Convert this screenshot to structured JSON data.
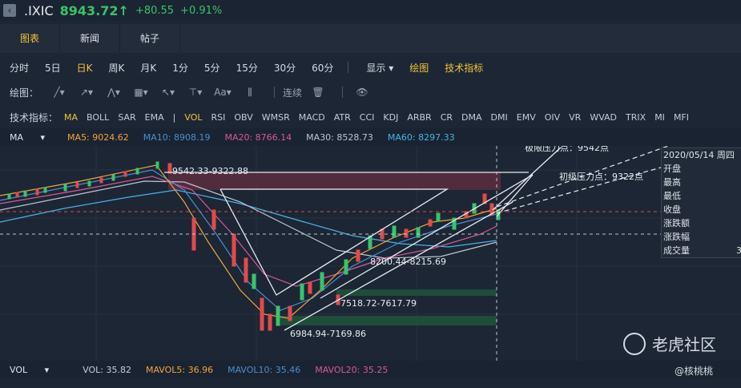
{
  "header": {
    "symbol": ".IXIC",
    "price": "8943.72",
    "change": "+80.55",
    "change_pct": "+0.91%",
    "color_up": "#38c46b"
  },
  "tabs": [
    "图表",
    "新闻",
    "帖子"
  ],
  "periods": [
    "分时",
    "5日",
    "日K",
    "周K",
    "月K",
    "1分",
    "5分",
    "15分",
    "30分",
    "60分"
  ],
  "period_active": "日K",
  "period_extra": [
    "显示",
    "绘图",
    "技术指标"
  ],
  "draw_bar": {
    "label": "绘图：",
    "continuous": "连续",
    "tools": [
      "line-tool-icon",
      "ray-tool-icon",
      "polyline-tool-icon",
      "fib-tool-icon",
      "arrow-tool-icon",
      "text-tool-icon",
      "font-tool-icon",
      "bar-tool-icon"
    ]
  },
  "indicators": {
    "label": "技术指标：",
    "items": [
      "MA",
      "BOLL",
      "SAR",
      "EMA",
      "|",
      "VOL",
      "RSI",
      "OBV",
      "WMSR",
      "MACD",
      "ATR",
      "CCI",
      "KDJ",
      "ARBR",
      "CR",
      "DMA",
      "DMI",
      "EMV",
      "OIV",
      "VR",
      "WVAD",
      "TRIX",
      "MI",
      "MFI"
    ]
  },
  "ma": {
    "label": "MA",
    "ma5": "MA5: 9024.62",
    "ma10": "MA10: 8908.19",
    "ma20": "MA20: 8766.14",
    "ma30": "MA30: 8528.73",
    "ma60": "MA60: 8297.33"
  },
  "annotations": {
    "top": "9542.33-9322.88",
    "mid": "8200.44-8215.69",
    "low": "7518.72-7617.79",
    "bottom": "6984.94-7169.86",
    "pressure1": "极限压力点：9542点",
    "pressure2": "初级压力点：9322点"
  },
  "tooltip": {
    "date": "2020/05/14 周四",
    "rows": [
      "开盘",
      "最高",
      "最低",
      "收盘",
      "涨跌额",
      "涨跌幅",
      "成交量"
    ],
    "vol_value": "3"
  },
  "vol": {
    "label": "VOL",
    "vol": "VOL: 35.82",
    "mavol5": "MAVOL5: 36.96",
    "mavol10": "MAVOL10: 35.46",
    "mavol20": "MAVOL20: 35.25"
  },
  "watermark": "老虎社区",
  "credit": "@核桃桃"
}
